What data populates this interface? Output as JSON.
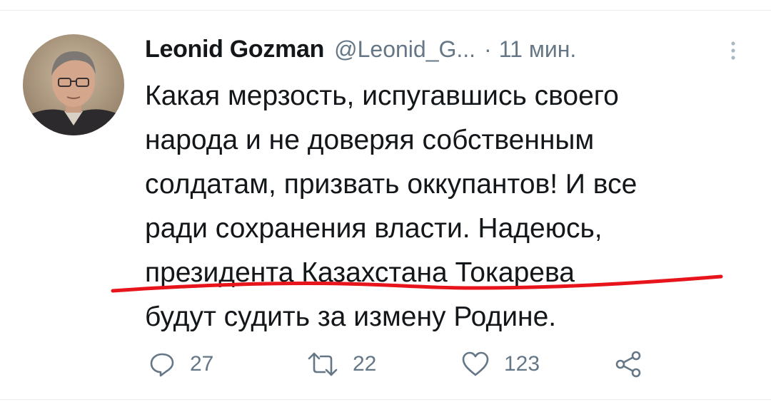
{
  "tweet": {
    "author_name": "Leonid Gozman",
    "author_handle": "@Leonid_G...",
    "separator": "·",
    "timestamp": "11 мин.",
    "text_lines": [
      "Какая мерзость, испугавшись своего",
      "народа и не доверяя собственным",
      "солдатам, призвать оккупантов! И все",
      "ради сохранения власти. Надеюсь,",
      "президента Казахстана Токарева",
      "будут судить за измену Родине."
    ]
  },
  "actions": {
    "reply_count": "27",
    "retweet_count": "22",
    "like_count": "123"
  },
  "icons": {
    "avatar": "avatar-photo",
    "more": "more-vertical-icon",
    "reply": "reply-icon",
    "retweet": "retweet-icon",
    "like": "heart-icon",
    "share": "share-icon"
  },
  "colors": {
    "text": "#14171a",
    "secondary": "#657786",
    "annotation": "#e8141b"
  }
}
